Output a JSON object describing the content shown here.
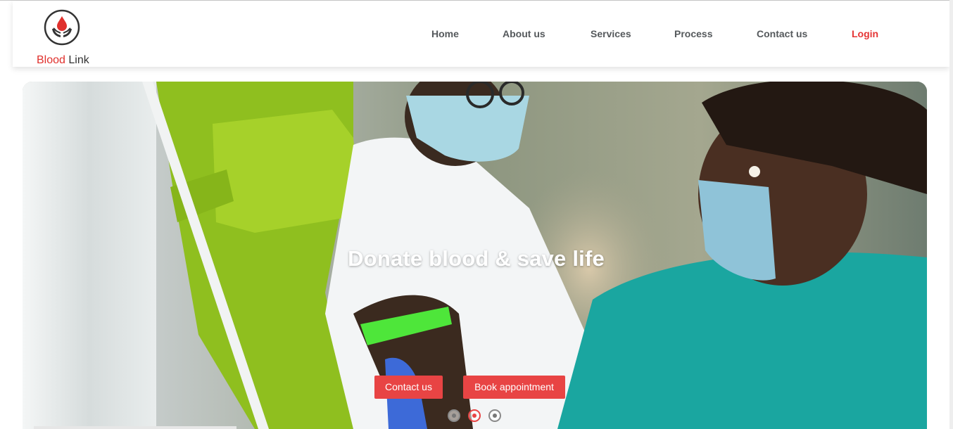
{
  "brand": {
    "name_part1": "Blood",
    "name_part2": "Link",
    "logo_icon": "blood-drop-hands-icon",
    "primary_color": "#e53535"
  },
  "nav": {
    "items": [
      {
        "label": "Home"
      },
      {
        "label": "About us"
      },
      {
        "label": "Services"
      },
      {
        "label": "Process"
      },
      {
        "label": "Contact us"
      }
    ],
    "login": "Login"
  },
  "hero": {
    "title": "Donate blood & save life",
    "buttons": {
      "contact": "Contact us",
      "book": "Book appointment"
    },
    "carousel": {
      "slide_count": 3,
      "active_index": 2
    }
  }
}
